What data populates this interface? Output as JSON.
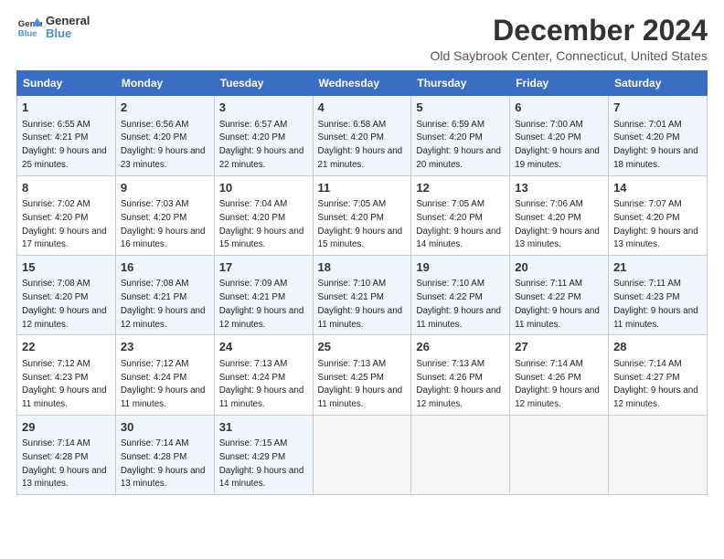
{
  "logo": {
    "line1": "General",
    "line2": "Blue"
  },
  "title": "December 2024",
  "location": "Old Saybrook Center, Connecticut, United States",
  "days_of_week": [
    "Sunday",
    "Monday",
    "Tuesday",
    "Wednesday",
    "Thursday",
    "Friday",
    "Saturday"
  ],
  "weeks": [
    [
      {
        "day": "1",
        "sunrise": "6:55 AM",
        "sunset": "4:21 PM",
        "daylight": "9 hours and 25 minutes."
      },
      {
        "day": "2",
        "sunrise": "6:56 AM",
        "sunset": "4:20 PM",
        "daylight": "9 hours and 23 minutes."
      },
      {
        "day": "3",
        "sunrise": "6:57 AM",
        "sunset": "4:20 PM",
        "daylight": "9 hours and 22 minutes."
      },
      {
        "day": "4",
        "sunrise": "6:58 AM",
        "sunset": "4:20 PM",
        "daylight": "9 hours and 21 minutes."
      },
      {
        "day": "5",
        "sunrise": "6:59 AM",
        "sunset": "4:20 PM",
        "daylight": "9 hours and 20 minutes."
      },
      {
        "day": "6",
        "sunrise": "7:00 AM",
        "sunset": "4:20 PM",
        "daylight": "9 hours and 19 minutes."
      },
      {
        "day": "7",
        "sunrise": "7:01 AM",
        "sunset": "4:20 PM",
        "daylight": "9 hours and 18 minutes."
      }
    ],
    [
      {
        "day": "8",
        "sunrise": "7:02 AM",
        "sunset": "4:20 PM",
        "daylight": "9 hours and 17 minutes."
      },
      {
        "day": "9",
        "sunrise": "7:03 AM",
        "sunset": "4:20 PM",
        "daylight": "9 hours and 16 minutes."
      },
      {
        "day": "10",
        "sunrise": "7:04 AM",
        "sunset": "4:20 PM",
        "daylight": "9 hours and 15 minutes."
      },
      {
        "day": "11",
        "sunrise": "7:05 AM",
        "sunset": "4:20 PM",
        "daylight": "9 hours and 15 minutes."
      },
      {
        "day": "12",
        "sunrise": "7:05 AM",
        "sunset": "4:20 PM",
        "daylight": "9 hours and 14 minutes."
      },
      {
        "day": "13",
        "sunrise": "7:06 AM",
        "sunset": "4:20 PM",
        "daylight": "9 hours and 13 minutes."
      },
      {
        "day": "14",
        "sunrise": "7:07 AM",
        "sunset": "4:20 PM",
        "daylight": "9 hours and 13 minutes."
      }
    ],
    [
      {
        "day": "15",
        "sunrise": "7:08 AM",
        "sunset": "4:20 PM",
        "daylight": "9 hours and 12 minutes."
      },
      {
        "day": "16",
        "sunrise": "7:08 AM",
        "sunset": "4:21 PM",
        "daylight": "9 hours and 12 minutes."
      },
      {
        "day": "17",
        "sunrise": "7:09 AM",
        "sunset": "4:21 PM",
        "daylight": "9 hours and 12 minutes."
      },
      {
        "day": "18",
        "sunrise": "7:10 AM",
        "sunset": "4:21 PM",
        "daylight": "9 hours and 11 minutes."
      },
      {
        "day": "19",
        "sunrise": "7:10 AM",
        "sunset": "4:22 PM",
        "daylight": "9 hours and 11 minutes."
      },
      {
        "day": "20",
        "sunrise": "7:11 AM",
        "sunset": "4:22 PM",
        "daylight": "9 hours and 11 minutes."
      },
      {
        "day": "21",
        "sunrise": "7:11 AM",
        "sunset": "4:23 PM",
        "daylight": "9 hours and 11 minutes."
      }
    ],
    [
      {
        "day": "22",
        "sunrise": "7:12 AM",
        "sunset": "4:23 PM",
        "daylight": "9 hours and 11 minutes."
      },
      {
        "day": "23",
        "sunrise": "7:12 AM",
        "sunset": "4:24 PM",
        "daylight": "9 hours and 11 minutes."
      },
      {
        "day": "24",
        "sunrise": "7:13 AM",
        "sunset": "4:24 PM",
        "daylight": "9 hours and 11 minutes."
      },
      {
        "day": "25",
        "sunrise": "7:13 AM",
        "sunset": "4:25 PM",
        "daylight": "9 hours and 11 minutes."
      },
      {
        "day": "26",
        "sunrise": "7:13 AM",
        "sunset": "4:26 PM",
        "daylight": "9 hours and 12 minutes."
      },
      {
        "day": "27",
        "sunrise": "7:14 AM",
        "sunset": "4:26 PM",
        "daylight": "9 hours and 12 minutes."
      },
      {
        "day": "28",
        "sunrise": "7:14 AM",
        "sunset": "4:27 PM",
        "daylight": "9 hours and 12 minutes."
      }
    ],
    [
      {
        "day": "29",
        "sunrise": "7:14 AM",
        "sunset": "4:28 PM",
        "daylight": "9 hours and 13 minutes."
      },
      {
        "day": "30",
        "sunrise": "7:14 AM",
        "sunset": "4:28 PM",
        "daylight": "9 hours and 13 minutes."
      },
      {
        "day": "31",
        "sunrise": "7:15 AM",
        "sunset": "4:29 PM",
        "daylight": "9 hours and 14 minutes."
      },
      null,
      null,
      null,
      null
    ]
  ],
  "labels": {
    "sunrise": "Sunrise:",
    "sunset": "Sunset:",
    "daylight": "Daylight:"
  }
}
